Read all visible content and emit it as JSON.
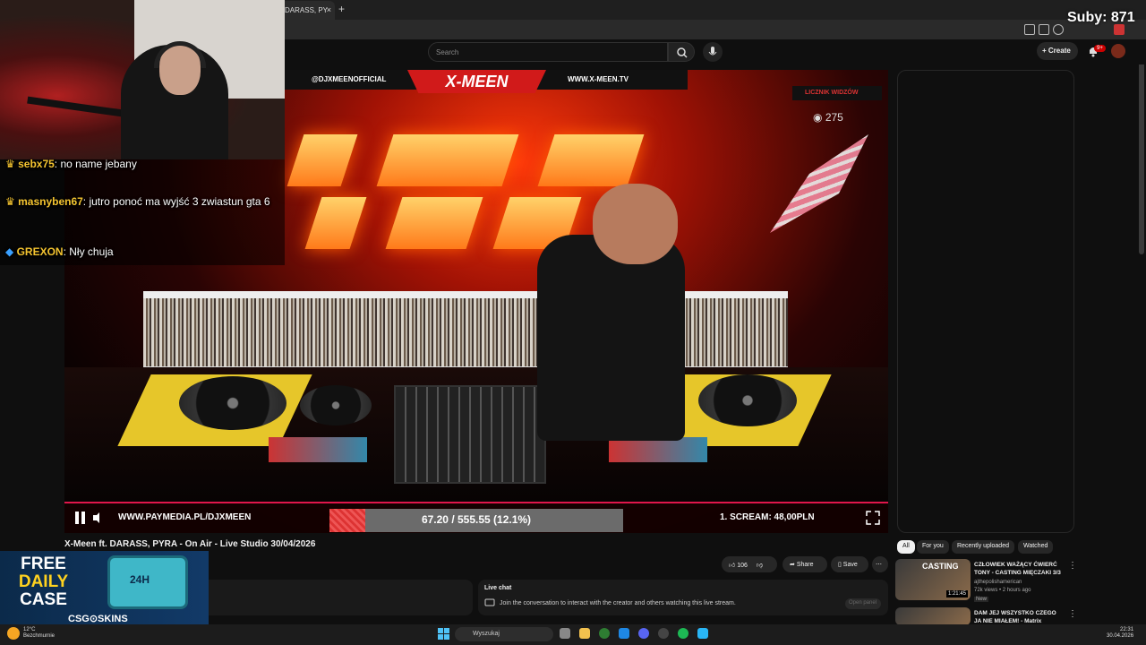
{
  "browser": {
    "tab_title": "DARASS, PY",
    "tab_close": "×",
    "new_tab": "+"
  },
  "youtube": {
    "search_placeholder": "Search",
    "create_label": "Create",
    "notif_badge": "9+"
  },
  "video": {
    "banner_social": "@DJXMEENOFFICIAL",
    "banner_logo": "X-MEEN",
    "banner_site": "WWW.X-MEEN.TV",
    "counter_label": "LICZNIK WIDZÓW",
    "viewers": "275",
    "payment_url": "WWW.PAYMEDIA.PL/DJXMEEN",
    "progress_text": "67.20 / 555.55 (12.1%)",
    "progress_fraction": 0.121,
    "scream_text": "1. SCREAM: 48,00PLN",
    "title": "X-Meen ft. DARASS, PYRA - On Air - Live Studio 30/04/2026"
  },
  "actions": {
    "likes": "106",
    "share": "Share",
    "save": "Save",
    "more": "⋯"
  },
  "live_chat": {
    "title": "Live chat",
    "message": "Join the conversation to interact with the creator and others watching this live stream.",
    "open_panel": "Open panel"
  },
  "filters": [
    "All",
    "For you",
    "Recently uploaded",
    "Watched"
  ],
  "recommendations": [
    {
      "title": "CZŁOWIEK WAŻĄCY ĆWIERĆ TONY - CASTING MIĘCZAKI 3/3",
      "channel": "ajthepolishamerican",
      "meta": "72k views • 2 hours ago",
      "badge": "New",
      "duration": "1:21:45",
      "thumb_text": "CASTING"
    },
    {
      "title": "DAM JEJ WSZYSTKO CZEGO JA NIE MIAŁEM! - Matrix",
      "channel": "",
      "meta": "",
      "badge": "",
      "duration": "",
      "thumb_text": ""
    }
  ],
  "stream_overlay": {
    "subs": "Suby: 871",
    "chat": [
      {
        "user": "sebx75",
        "text": ": no name jebany"
      },
      {
        "user": "masnyben67",
        "text": ": jutro ponoć ma wyjść 3 zwiastun gta 6"
      },
      {
        "user": "GREXON",
        "text": ": Nły chuja"
      }
    ]
  },
  "promo": {
    "line1": "FREE",
    "line2": "DAILY",
    "line3": "CASE",
    "chest": "24H",
    "brand": "CSG⊙SKINS"
  },
  "taskbar": {
    "temperature": "12°C",
    "weather": "Bezchmurnie",
    "search": "Wyszukaj",
    "time": "22:31",
    "date": "30.04.2026"
  },
  "colors": {
    "accent_red": "#e0164b",
    "yt_bg": "#0f0f0f",
    "chat_username": "#f4c430"
  }
}
